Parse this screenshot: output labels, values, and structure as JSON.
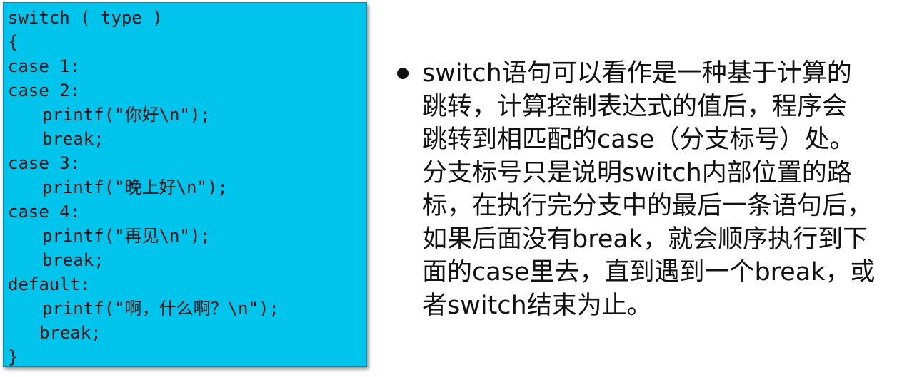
{
  "code": {
    "lines": [
      "switch ( type )",
      "{",
      "case 1:",
      "case 2:",
      "printf(\"你好\\n\");",
      "break;",
      "case 3:",
      "printf(\"晚上好\\n\");",
      "case 4:",
      "printf(\"再见\\n\");",
      "break;",
      "default:",
      "printf(\"啊，什么啊？\\n\");",
      "break;",
      "}"
    ]
  },
  "description": {
    "lines": [
      "switch语句可以看作是一种基于计算的",
      "跳转，计算控制表达式的值后，程序会",
      "跳转到相匹配的case（分支标号）处。",
      "分支标号只是说明switch内部位置的路",
      "标，在执行完分支中的最后一条语句后，",
      "如果后面没有break，就会顺序执行到下",
      "面的case里去，直到遇到一个break，或",
      "者switch结束为止。"
    ]
  }
}
